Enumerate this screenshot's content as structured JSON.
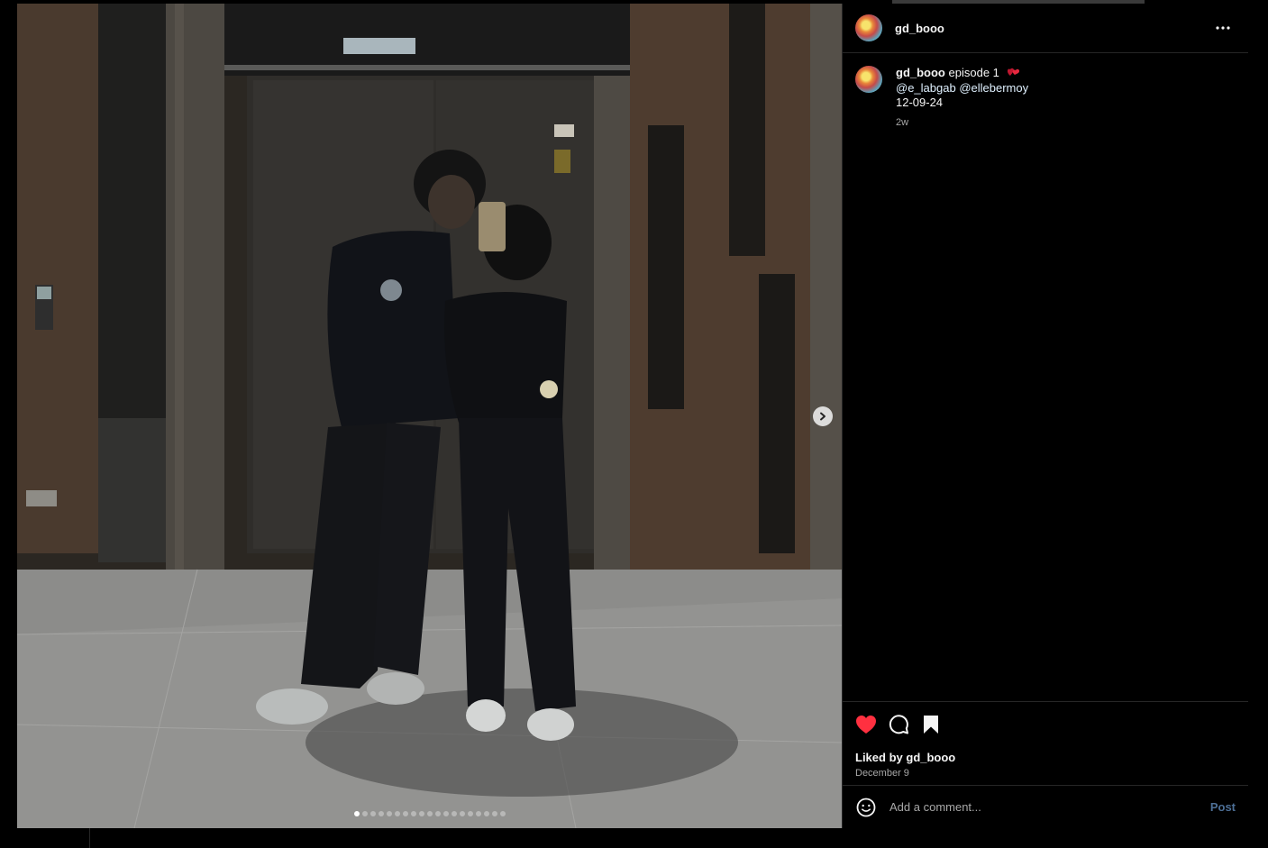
{
  "post": {
    "username": "gd_booo",
    "more_icon": "more-horizontal-icon"
  },
  "caption": {
    "username": "gd_booo",
    "text": "episode 1",
    "emoji": "red-hearts-emoji",
    "mention_1": "@e_labgab",
    "mention_2": "@ellebermoy",
    "date_line": "12-09-24",
    "time_ago": "2w"
  },
  "actions": {
    "like_icon": "heart-filled-icon",
    "comment_icon": "comment-bubble-icon",
    "save_icon": "bookmark-filled-icon",
    "liked_prefix": "Liked by",
    "liked_user": "gd_booo",
    "date": "December 9"
  },
  "comment_box": {
    "emoji_icon": "smiley-icon",
    "placeholder": "Add a comment...",
    "post_label": "Post"
  },
  "carousel": {
    "total_slides": 19,
    "current_index": 0,
    "next_icon": "chevron-right-icon"
  },
  "colors": {
    "like_red": "#ff3040",
    "post_button": "#4d6f96",
    "mention": "#e0f1ff"
  }
}
